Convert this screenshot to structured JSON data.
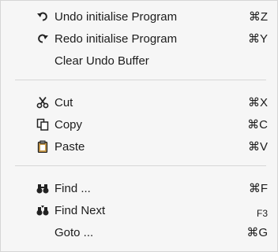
{
  "menu": {
    "groups": [
      {
        "items": [
          {
            "icon": "undo-icon",
            "label": "Undo initialise Program",
            "shortcut": "⌘Z"
          },
          {
            "icon": "redo-icon",
            "label": "Redo initialise Program",
            "shortcut": "⌘Y"
          },
          {
            "icon": "",
            "label": "Clear Undo Buffer",
            "shortcut": ""
          }
        ]
      },
      {
        "items": [
          {
            "icon": "scissors-icon",
            "label": "Cut",
            "shortcut": "⌘X"
          },
          {
            "icon": "copy-icon",
            "label": "Copy",
            "shortcut": "⌘C"
          },
          {
            "icon": "clipboard-icon",
            "label": "Paste",
            "shortcut": "⌘V"
          }
        ]
      },
      {
        "items": [
          {
            "icon": "binoculars-icon",
            "label": "Find ...",
            "shortcut": "⌘F"
          },
          {
            "icon": "find-next-icon",
            "label": "Find Next",
            "shortcut": "F3"
          },
          {
            "icon": "",
            "label": "Goto ...",
            "shortcut": "⌘G"
          }
        ]
      }
    ]
  }
}
